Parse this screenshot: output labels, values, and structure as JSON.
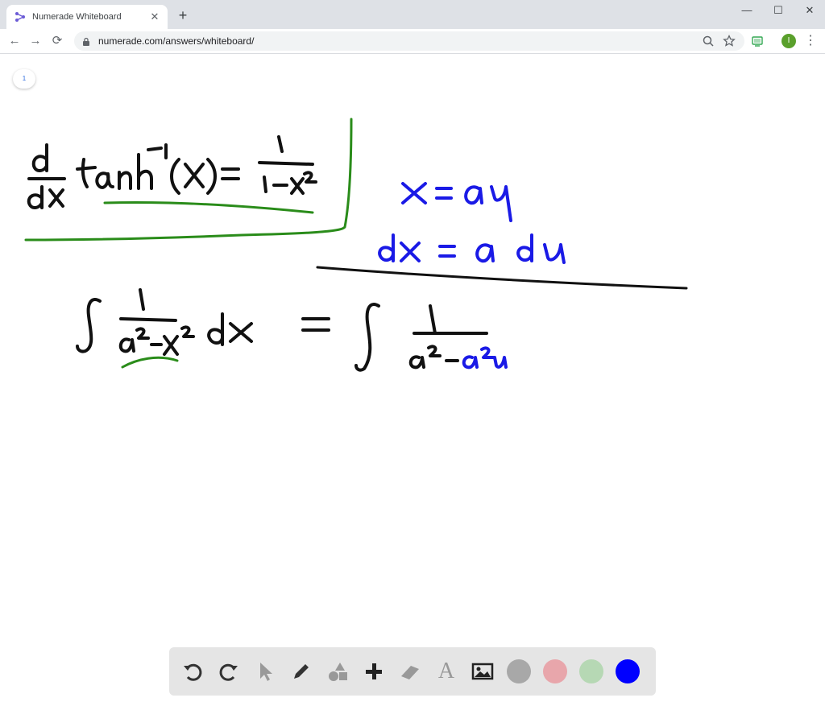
{
  "browser": {
    "tab_title": "Numerade Whiteboard",
    "tab_close": "✕",
    "new_tab": "+",
    "url": "numerade.com/answers/whiteboard/",
    "profile_initial": "I",
    "window_minimize": "—",
    "window_maximize": "☐",
    "window_close": "✕",
    "back": "←",
    "forward": "→",
    "reload": "⟳",
    "menu": "⋮"
  },
  "whiteboard": {
    "page_number": "1",
    "ink_colors": {
      "black": "#111111",
      "green": "#2a8c1a",
      "blue": "#1a1ae6"
    }
  },
  "toolbar": {
    "tools": [
      {
        "name": "undo-icon"
      },
      {
        "name": "redo-icon"
      },
      {
        "name": "pointer-icon"
      },
      {
        "name": "pen-icon"
      },
      {
        "name": "shapes-icon"
      },
      {
        "name": "add-icon"
      },
      {
        "name": "eraser-icon"
      },
      {
        "name": "text-icon",
        "glyph": "A"
      },
      {
        "name": "image-icon"
      }
    ],
    "colors": [
      "#a8a8a8",
      "#e8a6ab",
      "#b6d8b4",
      "#0000ff"
    ]
  }
}
